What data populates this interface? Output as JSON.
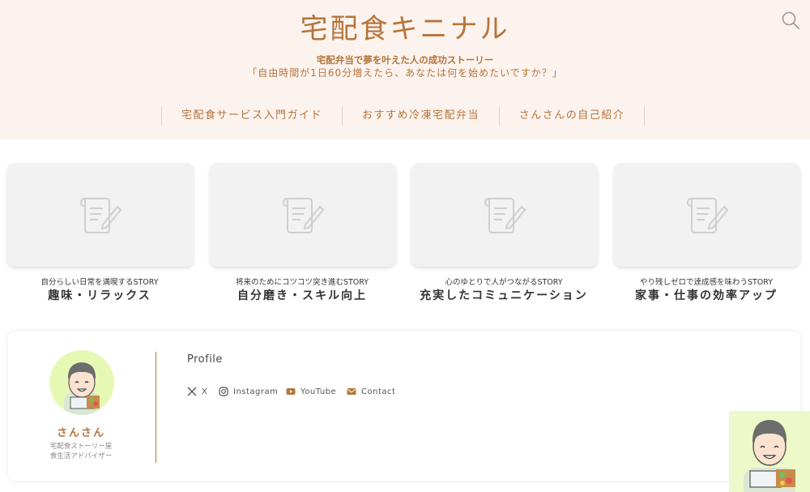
{
  "header": {
    "site_title": "宅配食キニナル",
    "tagline": "宅配弁当で夢を叶えた人の成功ストーリー",
    "subline": "「自由時間が1日60分増えたら、あなたは何を始めたいですか？」"
  },
  "nav": {
    "items": [
      {
        "label": "宅配食サービス入門ガイド"
      },
      {
        "label": "おすすめ冷凍宅配弁当"
      },
      {
        "label": "さんさんの自己紹介"
      }
    ]
  },
  "cards": [
    {
      "subtitle": "自分らしい日常を満喫するSTORY",
      "title": "趣味・リラックス"
    },
    {
      "subtitle": "将来のためにコツコツ突き進むSTORY",
      "title": "自分磨き・スキル向上"
    },
    {
      "subtitle": "心のゆとりで人がつながるSTORY",
      "title": "充実したコミュニケーション"
    },
    {
      "subtitle": "やり残しゼロで達成感を味わうSTORY",
      "title": "家事・仕事の効率アップ"
    }
  ],
  "profile": {
    "name": "さんさん",
    "role_line1": "宅配食ストーリー屋",
    "role_line2": "食生活アドバイザー",
    "heading": "Profile",
    "links": [
      {
        "label": "X",
        "icon": "x-icon"
      },
      {
        "label": "Instagram",
        "icon": "instagram-icon"
      },
      {
        "label": "YouTube",
        "icon": "youtube-icon"
      },
      {
        "label": "Contact",
        "icon": "mail-icon"
      }
    ]
  },
  "colors": {
    "accent": "#b5743a",
    "header_bg": "#fdf3ee",
    "card_bg": "#f2f2f2",
    "avatar_bg": "#e7f8b4"
  }
}
